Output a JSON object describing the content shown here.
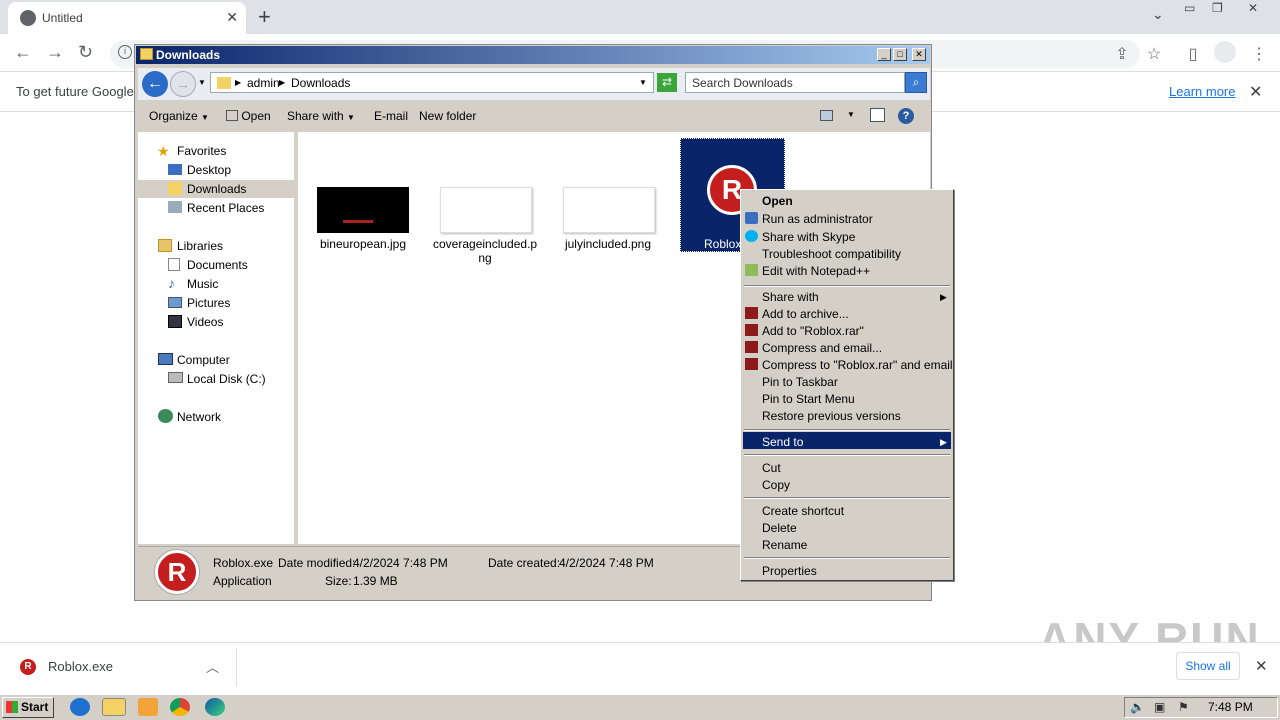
{
  "browser": {
    "tab_title": "Untitled",
    "new_tab": "+",
    "infobar_text": "To get future Google",
    "learn_more": "Learn more"
  },
  "explorer": {
    "title": "Downloads",
    "address": [
      "admin",
      "Downloads"
    ],
    "search_placeholder": "Search Downloads",
    "commands": {
      "organize": "Organize",
      "open": "Open",
      "share_with": "Share with",
      "email": "E-mail",
      "new_folder": "New folder"
    },
    "nav": {
      "favorites": "Favorites",
      "desktop": "Desktop",
      "downloads": "Downloads",
      "recent_places": "Recent Places",
      "libraries": "Libraries",
      "documents": "Documents",
      "music": "Music",
      "pictures": "Pictures",
      "videos": "Videos",
      "computer": "Computer",
      "local_disk": "Local Disk (C:)",
      "network": "Network"
    },
    "files": [
      {
        "name": "bineuropean.jpg"
      },
      {
        "name": "coverageincluded.p",
        "name2": "ng"
      },
      {
        "name": "julyincluded.png"
      },
      {
        "name": "Roblox."
      }
    ],
    "details": {
      "name": "Roblox.exe",
      "type": "Application",
      "modified_label": "Date modified:",
      "modified": "4/2/2024 7:48 PM",
      "created_label": "Date created:",
      "created": "4/2/2024 7:48 PM",
      "size_label": "Size:",
      "size": "1.39 MB"
    }
  },
  "context_menu": {
    "open": "Open",
    "run_as_admin": "Run as administrator",
    "share_skype": "Share with Skype",
    "troubleshoot": "Troubleshoot compatibility",
    "edit_npp": "Edit with Notepad++",
    "share_with": "Share with",
    "add_archive": "Add to archive...",
    "add_rar": "Add to \"Roblox.rar\"",
    "compress_email": "Compress and email...",
    "compress_rar_email": "Compress to \"Roblox.rar\" and email",
    "pin_taskbar": "Pin to Taskbar",
    "pin_start": "Pin to Start Menu",
    "restore": "Restore previous versions",
    "send_to": "Send to",
    "cut": "Cut",
    "copy": "Copy",
    "create_shortcut": "Create shortcut",
    "delete": "Delete",
    "rename": "Rename",
    "properties": "Properties"
  },
  "downloads_bar": {
    "file": "Roblox.exe",
    "show_all": "Show all"
  },
  "watermark": "ANY RUN",
  "taskbar": {
    "start": "Start",
    "clock": "7:48 PM"
  }
}
